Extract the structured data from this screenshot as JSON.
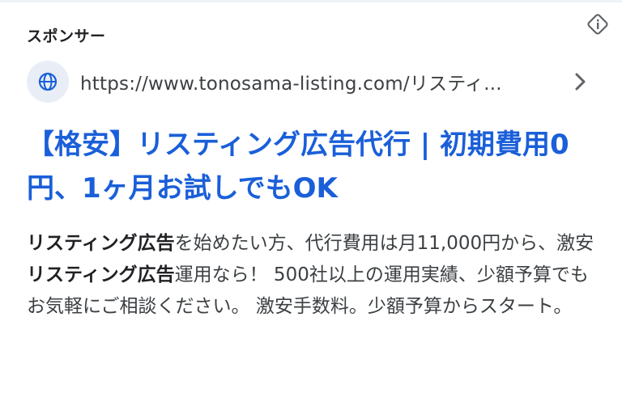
{
  "ad": {
    "sponsor_label": "スポンサー",
    "display_url": "https://www.tonosama-listing.com/リスティ...",
    "title": "【格安】リスティング広告代行 | 初期費用0円、1ヶ月お試しでもOK",
    "description": {
      "p1_bold": "リスティング広告",
      "p2": "を始めたい方、代行費用は月11,000円から、激安",
      "p3_bold": "リスティング広告",
      "p4": "運用なら！ 500社以上の運用実績、少額予算でもお気軽にご相談ください。 激安手数料。少額予算からスタート。"
    }
  },
  "icons": {
    "info": "info-diamond-icon",
    "globe": "globe-icon",
    "chevron": "chevron-right-icon"
  },
  "colors": {
    "title": "#1a5fd9",
    "text": "#3c4043",
    "badge_bg": "#e9eef6"
  }
}
